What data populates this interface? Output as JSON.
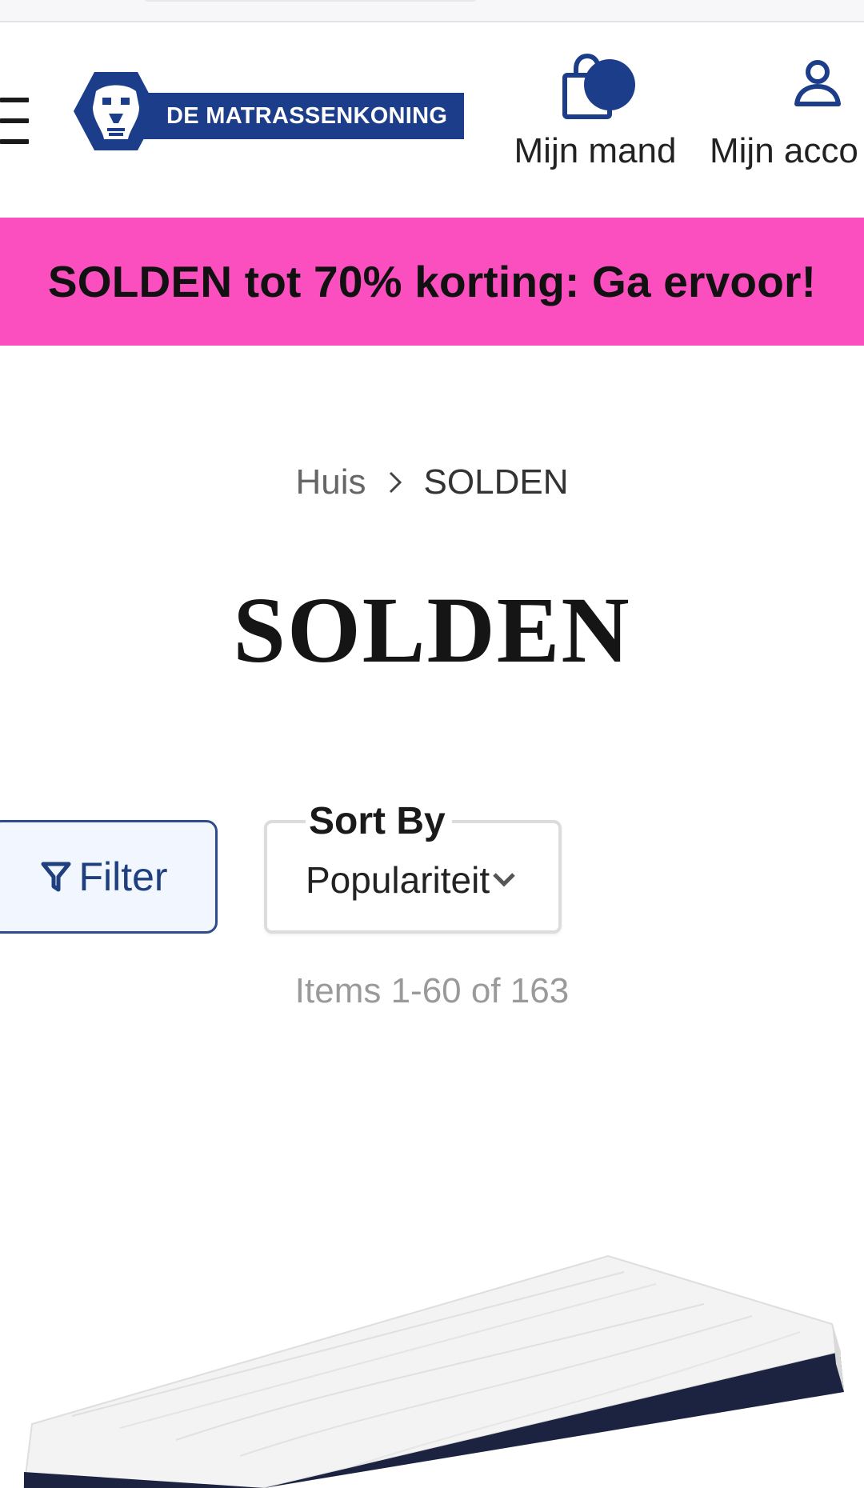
{
  "header": {
    "logo_text": "DE MATRASSENKONING",
    "cart_label": "Mijn mand",
    "account_label": "Mijn acco",
    "icons": [
      "menu-icon",
      "cart-icon",
      "account-icon",
      "lion-logo"
    ]
  },
  "promo": {
    "text": "SOLDEN tot 70% korting: Ga ervoor!",
    "background": "#fb4fbf"
  },
  "breadcrumb": {
    "home": "Huis",
    "current": "SOLDEN"
  },
  "page": {
    "title": "SOLDEN",
    "items_count": "Items 1-60 of 163"
  },
  "toolbar": {
    "filter_label": "Filter",
    "sort_label": "Sort By",
    "sort_value": "Populariteit"
  },
  "colors": {
    "brand_blue": "#1c3e8a",
    "promo_pink": "#fb4fbf"
  }
}
